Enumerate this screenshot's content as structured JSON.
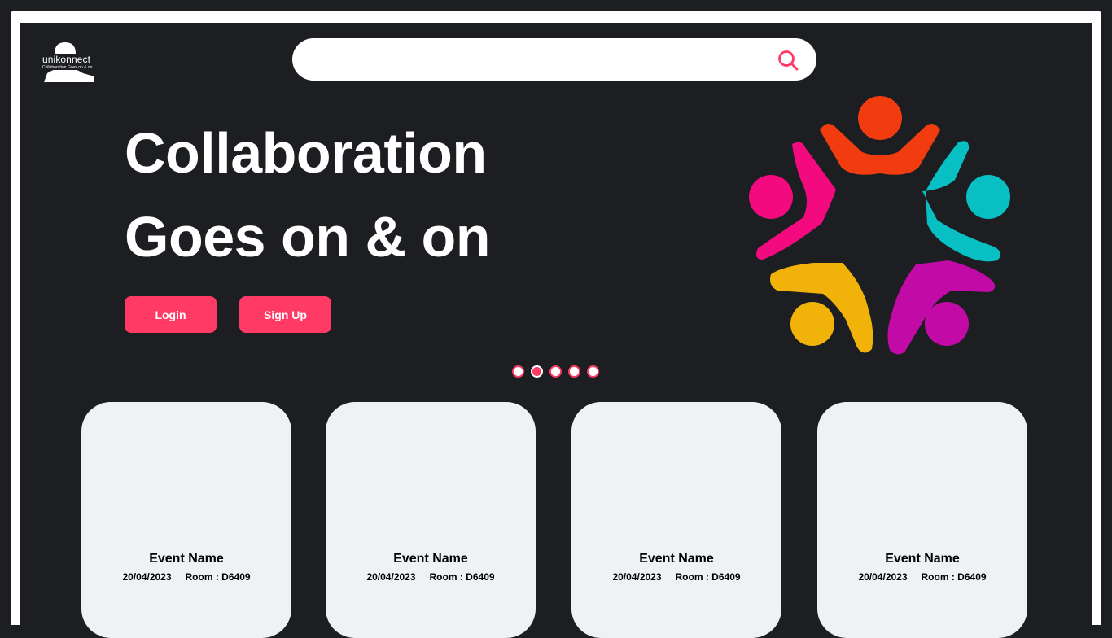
{
  "brand": {
    "name": "unikonnect",
    "tagline": "Collaboration Goes on & on"
  },
  "search": {
    "placeholder": "",
    "value": "",
    "icon": "search-icon"
  },
  "hero": {
    "title_line1": "Collaboration",
    "title_line2": "Goes on & on",
    "login_label": "Login",
    "signup_label": "Sign Up",
    "illustration": "people-circle-icon"
  },
  "carousel": {
    "count": 5,
    "active_index": 1
  },
  "events": [
    {
      "name": "Event Name",
      "date": "20/04/2023",
      "room": "Room : D6409"
    },
    {
      "name": "Event Name",
      "date": "20/04/2023",
      "room": "Room : D6409"
    },
    {
      "name": "Event Name",
      "date": "20/04/2023",
      "room": "Room : D6409"
    },
    {
      "name": "Event Name",
      "date": "20/04/2023",
      "room": "Room : D6409"
    }
  ],
  "colors": {
    "background": "#1c1e22",
    "accent": "#ff3a65",
    "card": "#eef2f5",
    "figure_red": "#f13c10",
    "figure_teal": "#08bfc3",
    "figure_magenta": "#c10aa6",
    "figure_yellow": "#f1b30a",
    "figure_pink": "#f20a7e"
  }
}
